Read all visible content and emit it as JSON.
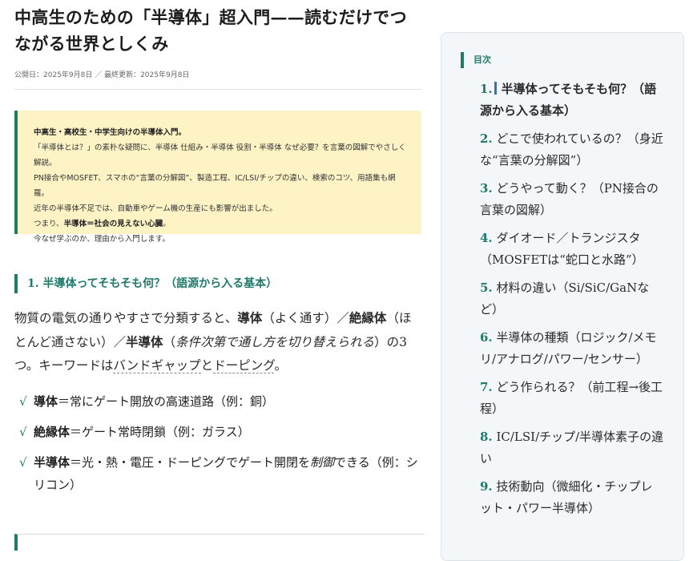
{
  "article": {
    "title": "中高生のための「半導体」超入門——読むだけでつながる世界としくみ",
    "meta": "公開日：2025年9月8日 ／ 最終更新：2025年9月8日",
    "intro": {
      "line1": "中高生・高校生・中学生向けの半導体入門。",
      "line2": "「半導体とは？」の素朴な疑問に、半導体 仕組み・半導体 役割・半導体 なぜ必要？を言葉の図解でやさしく解説。",
      "line3": "PN接合やMOSFET、スマホの“言葉の分解図”、製造工程、IC/LSI/チップの違い、検索のコツ、用語集も網羅。",
      "line4": "近年の半導体不足では、自動車やゲーム機の生産にも影響が出ました。",
      "line5_pre": "つまり、",
      "line5_bold": "半導体＝社会の見えない心臓",
      "line5_post": "。",
      "line6": "今なぜ学ぶのか、理由から入門します。"
    },
    "section1": {
      "heading": "1. 半導体ってそもそも何？（語源から入る基本）",
      "para": {
        "t1": "物質の電気の通りやすさで分類すると、",
        "b1": "導体",
        "t2": "（よく通す）／",
        "b2": "絶縁体",
        "t3": "（ほとんど通さない）／",
        "b3": "半導体",
        "t4": "（",
        "em1": "条件次第で通し方を切り替えられる",
        "t5": "）の3つ。キーワードは",
        "u1": "バンドギャップ",
        "t6": "と",
        "u2": "ドーピング",
        "t7": "。"
      },
      "list": [
        {
          "bold": "導体",
          "text": "＝常にゲート開放の高速道路（例：銅）"
        },
        {
          "bold": "絶縁体",
          "text": "＝ゲート常時閉鎖（例：ガラス）"
        },
        {
          "bold": "半導体",
          "text": "＝光・熱・電圧・ドーピングでゲート開閉を",
          "em": "制御",
          "text2": "できる（例：シリコン）"
        }
      ],
      "check_glyph": "√"
    }
  },
  "toc": {
    "title": "目次",
    "items": [
      {
        "num": "1.",
        "label": "半導体ってそもそも何？（語源から入る基本）"
      },
      {
        "num": "2.",
        "label": "どこで使われているの？（身近な“言葉の分解図”）"
      },
      {
        "num": "3.",
        "label": "どうやって動く？（PN接合の言葉の図解）"
      },
      {
        "num": "4.",
        "label": "ダイオード／トランジスタ（MOSFETは“蛇口と水路”）"
      },
      {
        "num": "5.",
        "label": "材料の違い（Si/SiC/GaNなど）"
      },
      {
        "num": "6.",
        "label": "半導体の種類（ロジック/メモリ/アナログ/パワー/センサー）"
      },
      {
        "num": "7.",
        "label": "どう作られる？（前工程→後工程）"
      },
      {
        "num": "8.",
        "label": "IC/LSI/チップ/半導体素子の違い"
      },
      {
        "num": "9.",
        "label": "技術動向（微細化・チップレット・パワー半導体）"
      }
    ]
  },
  "colors": {
    "accent": "#1f7a6a",
    "intro_bg": "#fdf3c4",
    "toc_bg": "#f4f7f9",
    "active_marker": "#2f6fd6"
  }
}
